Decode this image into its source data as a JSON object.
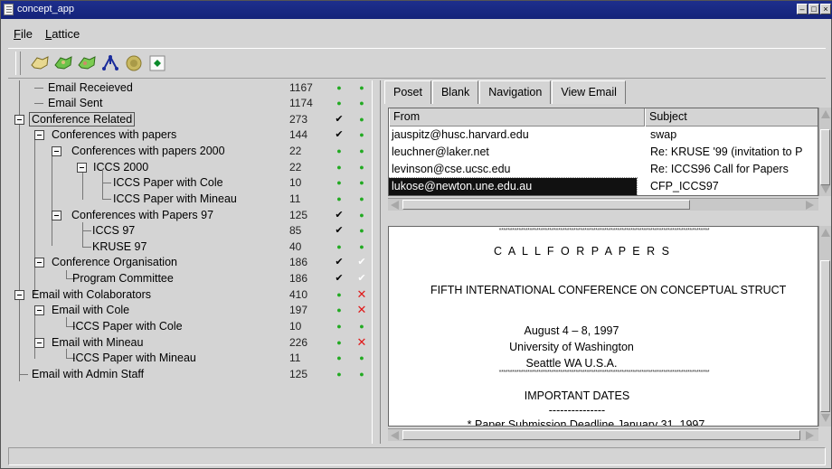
{
  "window": {
    "title": "concept_app"
  },
  "menu": {
    "file": "File",
    "file_key": "F",
    "file_rest": "ile",
    "lattice": "Lattice",
    "lattice_key": "L",
    "lattice_rest": "attice"
  },
  "toolbar": {
    "tools": [
      "hands-icon",
      "hands-green-icon",
      "hands-green-2-icon",
      "lattice-icon",
      "coin-icon",
      "green-diamond-icon"
    ]
  },
  "tree": {
    "items": [
      {
        "label": "Email Receieved",
        "count": "1167",
        "m1": "dot",
        "m2": "dot"
      },
      {
        "label": "Email Sent",
        "count": "1174",
        "m1": "dot",
        "m2": "dot"
      },
      {
        "label": "Conference Related",
        "count": "273",
        "m1": "check",
        "m2": "dot"
      },
      {
        "label": "Conferences with papers",
        "count": "144",
        "m1": "check",
        "m2": "dot"
      },
      {
        "label": "Conferences with papers 2000",
        "count": "22",
        "m1": "dot",
        "m2": "dot"
      },
      {
        "label": "ICCS 2000",
        "count": "22",
        "m1": "dot",
        "m2": "dot"
      },
      {
        "label": "ICCS Paper with Cole",
        "count": "10",
        "m1": "dot",
        "m2": "dot"
      },
      {
        "label": "ICCS Paper with Mineau",
        "count": "11",
        "m1": "dot",
        "m2": "dot"
      },
      {
        "label": "Conferences with Papers 97",
        "count": "125",
        "m1": "check",
        "m2": "dot"
      },
      {
        "label": "ICCS 97",
        "count": "85",
        "m1": "check",
        "m2": "dot"
      },
      {
        "label": "KRUSE 97",
        "count": "40",
        "m1": "dot",
        "m2": "dot"
      },
      {
        "label": "Conference Organisation",
        "count": "186",
        "m1": "check",
        "m2": "check-w"
      },
      {
        "label": "Program Committee",
        "count": "186",
        "m1": "check",
        "m2": "check-w"
      },
      {
        "label": "Email with Colaborators",
        "count": "410",
        "m1": "dot",
        "m2": "cross"
      },
      {
        "label": "Email with Cole",
        "count": "197",
        "m1": "dot",
        "m2": "cross"
      },
      {
        "label": "ICCS Paper with Cole",
        "count": "10",
        "m1": "dot",
        "m2": "dot"
      },
      {
        "label": "Email with Mineau",
        "count": "226",
        "m1": "dot",
        "m2": "cross"
      },
      {
        "label": "ICCS Paper with Mineau",
        "count": "11",
        "m1": "dot",
        "m2": "dot"
      },
      {
        "label": "Email with Admin Staff",
        "count": "125",
        "m1": "dot",
        "m2": "dot"
      }
    ]
  },
  "tabs": [
    "Poset",
    "Blank",
    "Navigation",
    "View Email"
  ],
  "email_list": {
    "columns": [
      "From",
      "Subject"
    ],
    "rows": [
      {
        "from": "jauspitz@husc.harvard.edu",
        "subject": "swap"
      },
      {
        "from": "leuchner@laker.net",
        "subject": "Re: KRUSE '99 (invitation to P"
      },
      {
        "from": "levinson@cse.ucsc.edu",
        "subject": "Re:  ICCS96 Call for Papers"
      },
      {
        "from": "lukose@newton.une.edu.au",
        "subject": "CFP_ICCS97"
      }
    ]
  },
  "email_body": {
    "stars": "************************************************************************************************",
    "lines": [
      "C A L L   F O R   P A P E R S",
      "FIFTH INTERNATIONAL CONFERENCE ON CONCEPTUAL STRUCT",
      "August 4 – 8, 1997",
      "University of Washington",
      "Seattle WA U.S.A.",
      "IMPORTANT DATES",
      "---------------",
      "* Paper Submission Deadline      January 31, 1997"
    ]
  }
}
